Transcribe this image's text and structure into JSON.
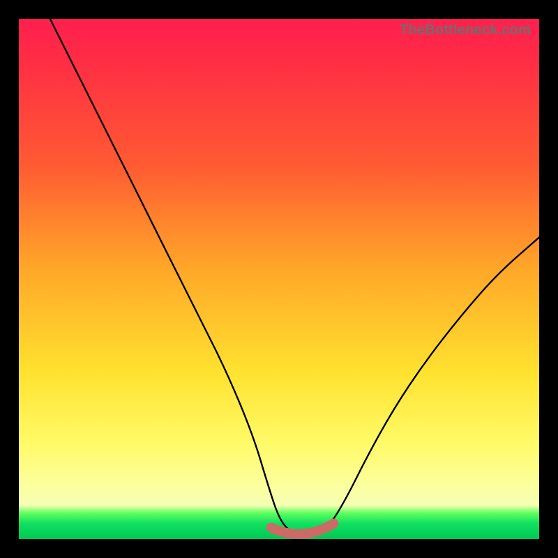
{
  "watermark": "TheBottleneck.com",
  "colors": {
    "frame": "#000000",
    "curve_stroke": "#000000",
    "marker_stroke": "#cc6a66",
    "gradient_top": "#ff1f4f",
    "gradient_bottom": "#00c853"
  },
  "chart_data": {
    "type": "line",
    "title": "",
    "xlabel": "",
    "ylabel": "",
    "xlim": [
      0,
      100
    ],
    "ylim": [
      0,
      100
    ],
    "grid": false,
    "legend": false,
    "series": [
      {
        "name": "bottleneck-curve",
        "x": [
          6,
          10,
          15,
          20,
          25,
          30,
          35,
          40,
          45,
          48,
          50,
          52,
          54,
          56,
          58,
          60,
          63,
          67,
          72,
          78,
          85,
          92,
          100
        ],
        "y": [
          100,
          92,
          82,
          72,
          62,
          52,
          42,
          32,
          20,
          10,
          4,
          1.5,
          1,
          1,
          1.5,
          3,
          8,
          16,
          25,
          34,
          43,
          51,
          58
        ]
      }
    ],
    "markers": {
      "name": "bottom-highlight",
      "x": [
        48.5,
        50,
        51.5,
        53,
        54.5,
        56,
        57.5,
        59,
        60.5
      ],
      "y": [
        2.2,
        1.6,
        1.2,
        1.0,
        1.0,
        1.2,
        1.6,
        2.2,
        3.0
      ]
    }
  }
}
